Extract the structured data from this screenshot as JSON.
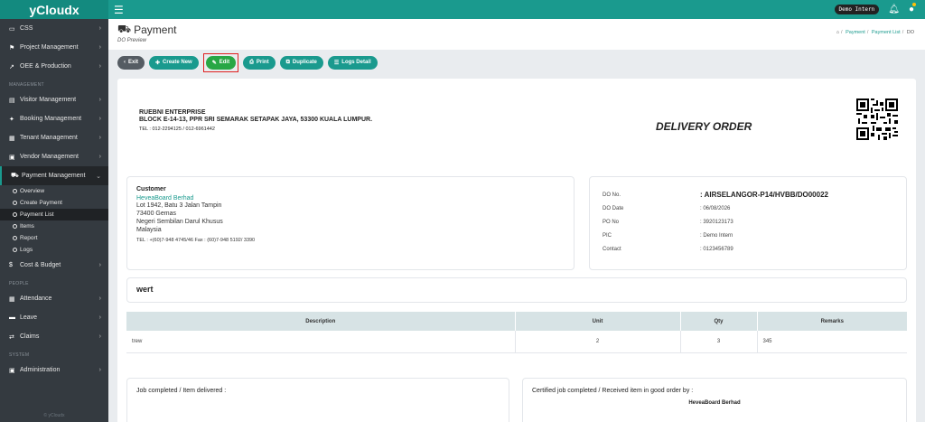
{
  "app": {
    "brand": "yCloudx",
    "user": "Demo Intern"
  },
  "sidebar": {
    "top_items": [
      {
        "label": "CSS",
        "icon": "monitor-icon"
      },
      {
        "label": "Project Management",
        "icon": "flag-icon"
      },
      {
        "label": "OEE & Production",
        "icon": "chart-line-icon"
      }
    ],
    "section_management": "MANAGEMENT",
    "management_items": [
      {
        "label": "Visitor Management",
        "icon": "id-card-icon"
      },
      {
        "label": "Booking Management",
        "icon": "pin-icon"
      },
      {
        "label": "Tenant Management",
        "icon": "building-icon"
      },
      {
        "label": "Vendor Management",
        "icon": "vendor-card-icon"
      },
      {
        "label": "Payment Management",
        "icon": "cart-icon"
      }
    ],
    "payment_sub": [
      "Overview",
      "Create Payment",
      "Payment List",
      "Items",
      "Report",
      "Logs"
    ],
    "cost_item": {
      "label": "Cost & Budget",
      "icon": "dollar-icon"
    },
    "section_people": "PEOPLE",
    "people_items": [
      {
        "label": "Attendance",
        "icon": "calendar-icon"
      },
      {
        "label": "Leave",
        "icon": "bed-icon"
      },
      {
        "label": "Claims",
        "icon": "exchange-icon"
      }
    ],
    "section_system": "SYSTEM",
    "system_items": [
      {
        "label": "Administration",
        "icon": "admin-icon"
      }
    ],
    "footer": "© yCloudx"
  },
  "page": {
    "title": "Payment",
    "subtitle": "DO Preview",
    "breadcrumb": [
      "Payment",
      "Payment List",
      "DO"
    ]
  },
  "toolbar": {
    "exit": "Exit",
    "create_new": "Create New",
    "edit": "Edit",
    "print": "Print",
    "duplicate": "Duplicate",
    "logs_detail": "Logs Detail"
  },
  "document": {
    "company_name": "RUEBNI ENTERPRISE",
    "company_address": "BLOCK E-14-13, PPR SRI SEMARAK SETAPAK JAYA, 53300 KUALA LUMPUR.",
    "company_tel": "TEL : 012-2294125 / 012-6961442",
    "doc_title": "DELIVERY ORDER",
    "customer": {
      "label": "Customer",
      "name": "HeveaBoard Berhad",
      "lines": [
        "Lot 1942, Batu 3 Jalan Tampin",
        "73400 Gemas",
        "Negeri Sembilan Darul Khusus",
        "Malaysia"
      ],
      "tel_fax": "TEL : +(60)7-948 4745/46   Fax : (60)7-948 5192/ 3390"
    },
    "do_info": {
      "do_no_label": "DO No.",
      "do_no": ": AIRSELANGOR-P14/HVBB/DO00022",
      "do_date_label": "DO Date",
      "do_date": ": 06/08/2026",
      "po_no_label": "PO No",
      "po_no": ": 3920123173",
      "pic_label": "PIC",
      "pic": ": Demo Intern",
      "contact_label": "Contact",
      "contact": ": 0123456789"
    },
    "remark": "wert",
    "table": {
      "headers": {
        "description": "Description",
        "unit": "Unit",
        "qty": "Qty",
        "remarks": "Remarks"
      },
      "rows": [
        {
          "description": "trew",
          "unit": "2",
          "qty": "3",
          "remarks": "345"
        }
      ]
    },
    "sign_left": "Job completed / Item delivered :",
    "sign_right": "Certified job completed / Received item in good order by :",
    "sign_company": "HeveaBoard Berhad"
  },
  "colors": {
    "brand": "#1a9a8e",
    "sidebar": "#343a40",
    "edit_highlight": "#e02020"
  }
}
